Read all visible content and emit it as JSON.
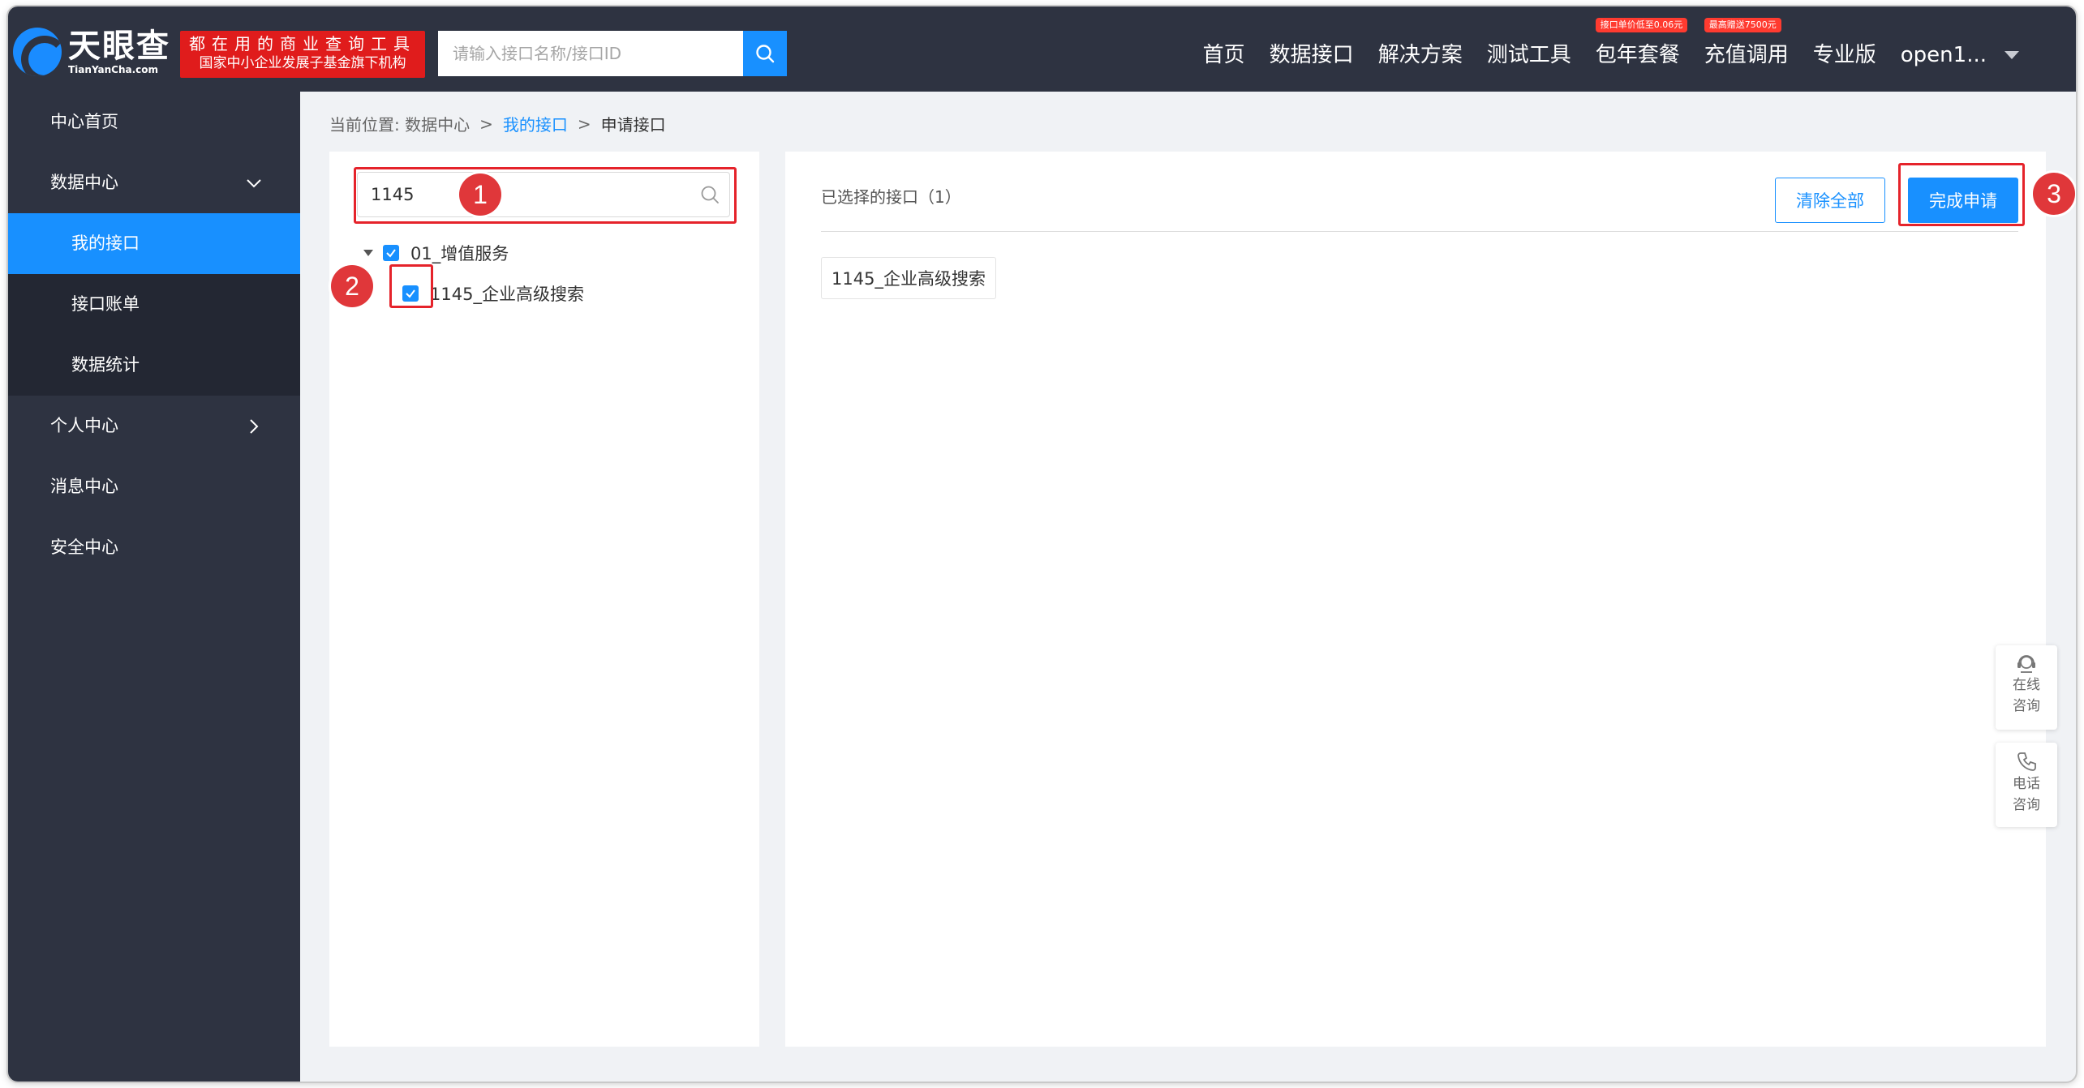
{
  "header": {
    "logo": {
      "cn": "天眼查",
      "en": "TianYanCha.com"
    },
    "promo": {
      "line1": "都在用的商业查询工具",
      "line2": "国家中小企业发展子基金旗下机构"
    },
    "search": {
      "placeholder": "请输入接口名称/接口ID",
      "value": ""
    },
    "nav": [
      {
        "label": "首页",
        "badge": ""
      },
      {
        "label": "数据接口",
        "badge": ""
      },
      {
        "label": "解决方案",
        "badge": ""
      },
      {
        "label": "测试工具",
        "badge": ""
      },
      {
        "label": "包年套餐",
        "badge": "接口单价低至0.06元"
      },
      {
        "label": "充值调用",
        "badge": "最高赠送7500元"
      },
      {
        "label": "专业版",
        "badge": ""
      }
    ],
    "user": "open1..."
  },
  "sidebar": {
    "items": [
      {
        "label": "中心首页"
      },
      {
        "label": "数据中心",
        "expanded": true
      },
      {
        "label": "我的接口",
        "active": true
      },
      {
        "label": "接口账单"
      },
      {
        "label": "数据统计"
      },
      {
        "label": "个人中心",
        "expanded": false
      },
      {
        "label": "消息中心"
      },
      {
        "label": "安全中心"
      }
    ]
  },
  "breadcrumb": {
    "prefix": "当前位置: 数据中心",
    "link": "我的接口",
    "current": "申请接口",
    "separator": ">"
  },
  "tree": {
    "filter_value": "1145",
    "group": {
      "label": "01_增值服务",
      "checked": true
    },
    "item": {
      "label": "1145_企业高级搜索",
      "checked": true
    }
  },
  "selected": {
    "title": "已选择的接口（1）",
    "clear_label": "清除全部",
    "done_label": "完成申请",
    "tags": [
      "1145_企业高级搜索"
    ]
  },
  "annotations": [
    "1",
    "2",
    "3"
  ],
  "float_widgets": [
    {
      "label1": "在线",
      "label2": "咨询",
      "icon": "headset-icon"
    },
    {
      "label1": "电话",
      "label2": "咨询",
      "icon": "phone-icon"
    }
  ],
  "colors": {
    "header_bg": "#2e3341",
    "accent": "#1890ff",
    "highlight_red": "#e5232b",
    "promo_red": "#e01c1c"
  }
}
